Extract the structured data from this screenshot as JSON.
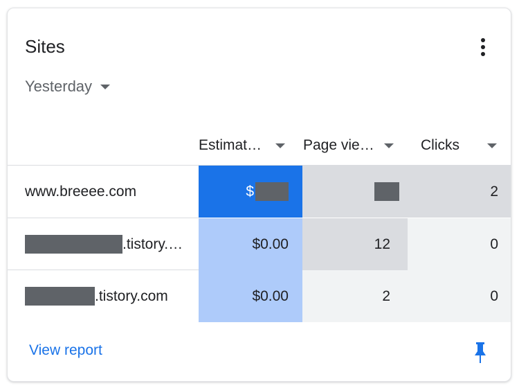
{
  "card": {
    "title": "Sites",
    "more_icon": "more-vert-icon",
    "date_range": "Yesterday",
    "columns": [
      {
        "label": "Estimat…"
      },
      {
        "label": "Page vie…"
      },
      {
        "label": "Clicks"
      }
    ],
    "rows": [
      {
        "site": "www.breeee.com",
        "site_redacted_prefix": false,
        "earnings": "$",
        "earnings_redacted": true,
        "page_views": "",
        "page_views_redacted": true,
        "clicks": "2"
      },
      {
        "site": ".tistory.…",
        "site_redacted_prefix": true,
        "earnings": "$0.00",
        "earnings_redacted": false,
        "page_views": "12",
        "page_views_redacted": false,
        "clicks": "0"
      },
      {
        "site": ".tistory.com",
        "site_redacted_prefix": true,
        "earnings": "$0.00",
        "earnings_redacted": false,
        "page_views": "2",
        "page_views_redacted": false,
        "clicks": "0"
      }
    ],
    "footer": {
      "view_report": "View report",
      "pin_icon": "pin-icon"
    }
  },
  "colors": {
    "accent": "#1a73e8",
    "heat_strong": "#1a73e8",
    "heat_light": "#aecbfa",
    "gray_dark": "#dadce0",
    "gray_light": "#f1f3f4",
    "redaction": "#5f6368"
  }
}
